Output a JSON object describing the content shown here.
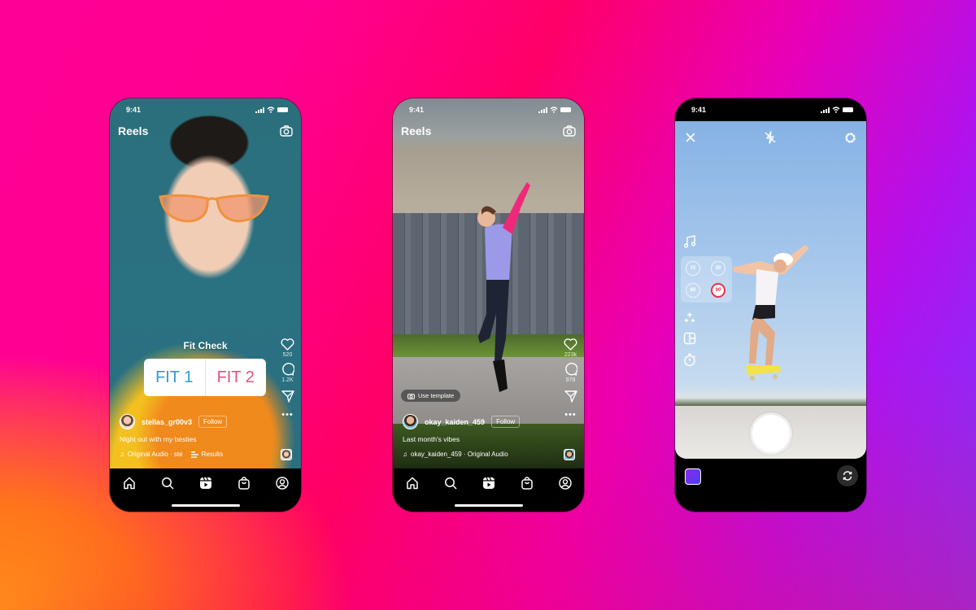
{
  "background": {
    "gradient_colors": [
      "#ff0095",
      "#ff0068",
      "#ffd000",
      "#b012ee",
      "#7a38ff"
    ]
  },
  "phones": [
    {
      "status": {
        "time": "9:41"
      },
      "header": {
        "title": "Reels",
        "camera_icon": "camera-icon"
      },
      "poll": {
        "title": "Fit Check",
        "options": [
          {
            "label": "FIT 1",
            "color": "#2f9bd6"
          },
          {
            "label": "FIT 2",
            "color": "#e2527a"
          }
        ]
      },
      "actions": {
        "likes": "520",
        "comments": "1.2K",
        "more": "•••"
      },
      "author": {
        "username": "stellas_gr00v3",
        "follow_label": "Follow"
      },
      "caption": "Night out with my besties",
      "audio": {
        "label": "Original Audio · ste",
        "results_label": "Results"
      },
      "nav": [
        "home",
        "search",
        "reels",
        "shop",
        "profile"
      ]
    },
    {
      "status": {
        "time": "9:41"
      },
      "header": {
        "title": "Reels",
        "camera_icon": "camera-icon"
      },
      "use_template_label": "Use template",
      "actions": {
        "likes": "223k",
        "comments": "978",
        "more": "•••"
      },
      "author": {
        "username": "okay_kaiden_459",
        "follow_label": "Follow"
      },
      "caption": "Last month's vibes",
      "audio": {
        "label": "okay_kaiden_459 · Original Audio"
      },
      "nav": [
        "home",
        "search",
        "reels",
        "shop",
        "profile"
      ]
    },
    {
      "status": {
        "time": "9:41"
      },
      "camera": {
        "top_controls": [
          "close",
          "flash-off",
          "settings"
        ],
        "tools": [
          "music",
          "duration",
          "effects",
          "layout",
          "timer"
        ],
        "durations": [
          {
            "label": "15",
            "active": false
          },
          {
            "label": "30",
            "active": false
          },
          {
            "label": "60",
            "active": false
          },
          {
            "label": "90",
            "active": true
          }
        ],
        "accent": "#e8334a"
      }
    }
  ]
}
